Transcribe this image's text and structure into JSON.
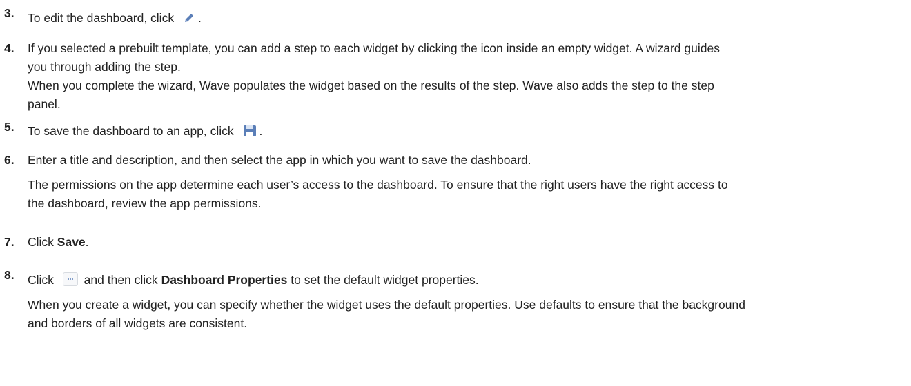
{
  "colors": {
    "text": "#222222",
    "icon_blue": "#5b7fb8"
  },
  "steps": [
    {
      "num": "3.",
      "before": "To edit the dashboard, click",
      "icon": "pencil-icon",
      "after": "."
    },
    {
      "num": "4.",
      "line1": "If you selected a prebuilt template, you can add a step to each widget by clicking the icon inside an empty widget. A wizard guides",
      "line2": "you through adding the step.",
      "line3": "When you complete the wizard, Wave populates the widget based on the results of the step. Wave also adds the step to the step",
      "line4": "panel."
    },
    {
      "num": "5.",
      "before": "To save the dashboard to an app, click",
      "icon": "save-icon",
      "after": "."
    },
    {
      "num": "6.",
      "line1": "Enter a title and description, and then select the app in which you want to save the dashboard.",
      "line2": "The permissions on the app determine each user’s access to the dashboard. To ensure that the right users have the right access to",
      "line3": "the dashboard, review the app permissions."
    },
    {
      "num": "7.",
      "before": "Click",
      "bold": "Save",
      "after": "."
    },
    {
      "num": "8.",
      "before": "Click",
      "icon": "more-icon",
      "middle": "and then click",
      "bold": "Dashboard Properties",
      "after": "to set the default widget properties.",
      "line2": "When you create a widget, you can specify whether the widget uses the default properties. Use defaults to ensure that the background",
      "line3": "and borders of all widgets are consistent."
    }
  ]
}
